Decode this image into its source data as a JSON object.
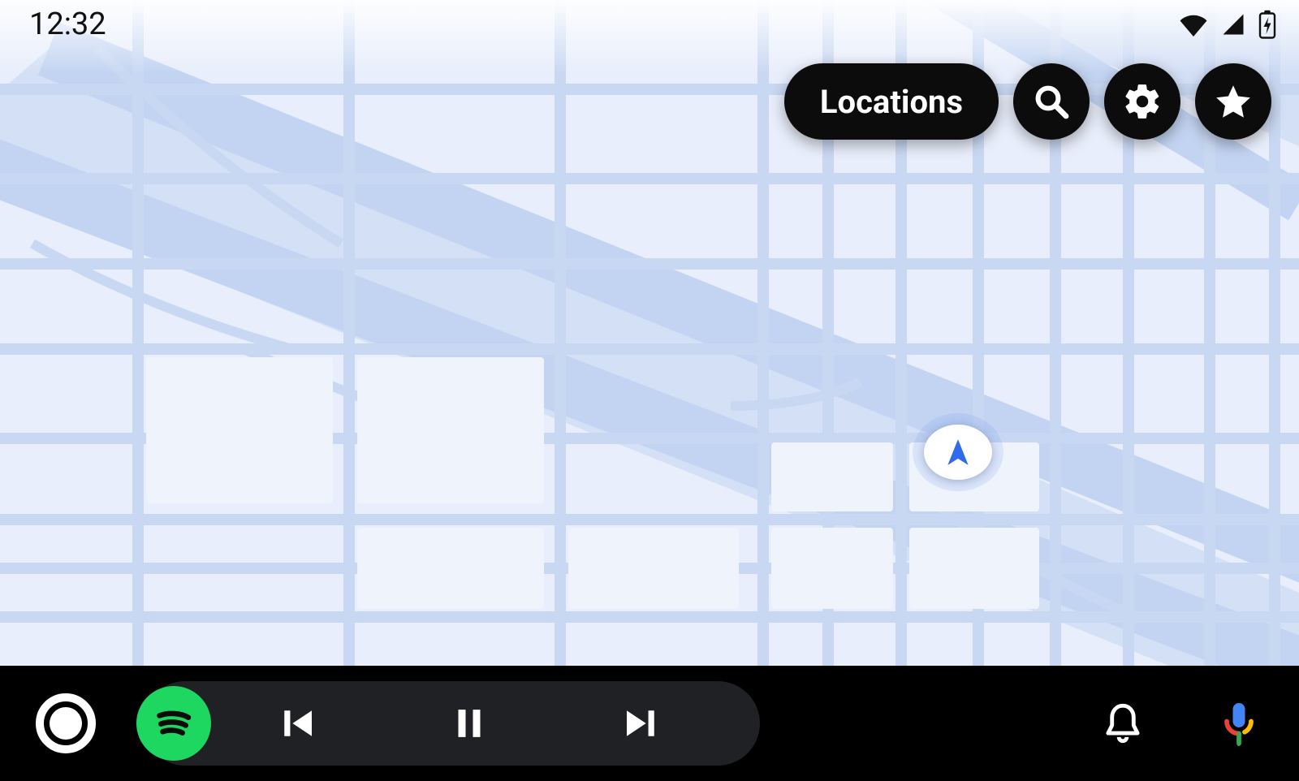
{
  "status_bar": {
    "time": "12:32",
    "icons": [
      "wifi-icon",
      "cell-signal-icon",
      "battery-charging-icon"
    ]
  },
  "map": {
    "controls": {
      "locations_label": "Locations",
      "buttons": [
        "search-icon",
        "gear-icon",
        "star-icon"
      ]
    },
    "marker": "current-location"
  },
  "car_bar": {
    "home": "home-button",
    "media": {
      "app": "spotify",
      "buttons": [
        "previous-track",
        "pause",
        "next-track"
      ]
    },
    "right_icons": [
      "bell-icon",
      "assistant-mic-icon"
    ]
  },
  "colors": {
    "dark": "#0c0c0c",
    "map_bg": "#e8eefb",
    "road": "#c9d8f2",
    "spotify": "#1ed760",
    "assistant_blue": "#4285f4",
    "assistant_red": "#ea4335",
    "assistant_yellow": "#fbbc05",
    "assistant_green": "#34a853"
  }
}
